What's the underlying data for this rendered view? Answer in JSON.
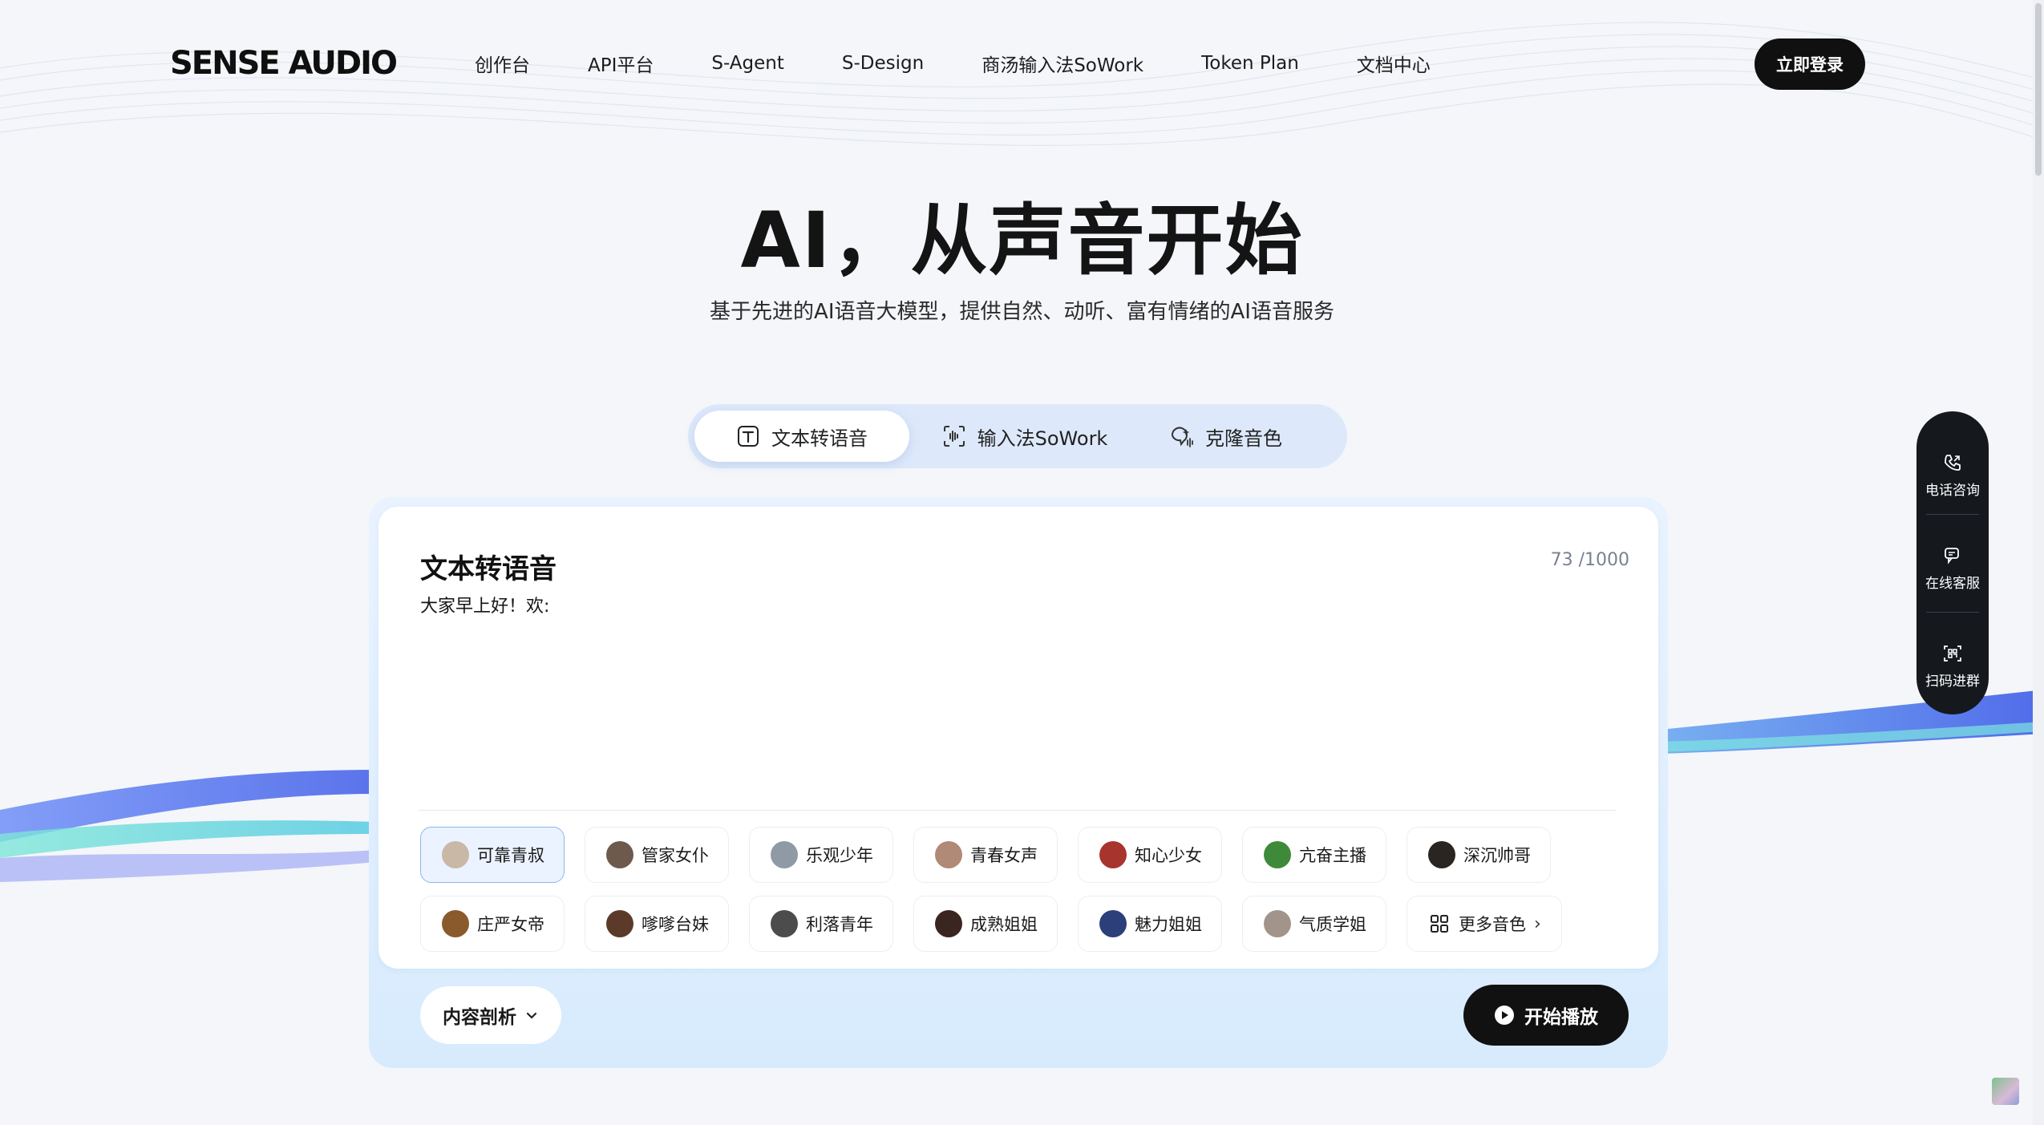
{
  "header": {
    "logo": "SENSE AUDIO",
    "nav": [
      "创作台",
      "API平台",
      "S-Agent",
      "S-Design",
      "商汤输入法SoWork",
      "Token Plan",
      "文档中心"
    ],
    "login_label": "立即登录"
  },
  "hero": {
    "title": "AI，从声音开始",
    "subtitle": "基于先进的AI语音大模型，提供自然、动听、富有情绪的AI语音服务"
  },
  "tabs": [
    {
      "label": "文本转语音",
      "icon": "text-t-icon",
      "active": true
    },
    {
      "label": "输入法SoWork",
      "icon": "voice-scan-icon",
      "active": false
    },
    {
      "label": "克隆音色",
      "icon": "clone-voice-icon",
      "active": false
    }
  ],
  "panel": {
    "title": "文本转语音",
    "char_count": "73 /1000",
    "text": "大家早上好！欢:",
    "voices": [
      {
        "name": "可靠青叔",
        "selected": true,
        "avatar": "#c9b8a6"
      },
      {
        "name": "管家女仆",
        "selected": false,
        "avatar": "#6d5a4c"
      },
      {
        "name": "乐观少年",
        "selected": false,
        "avatar": "#8f9aa6"
      },
      {
        "name": "青春女声",
        "selected": false,
        "avatar": "#b08977"
      },
      {
        "name": "知心少女",
        "selected": false,
        "avatar": "#a8342e"
      },
      {
        "name": "亢奋主播",
        "selected": false,
        "avatar": "#3f8a3a"
      },
      {
        "name": "深沉帅哥",
        "selected": false,
        "avatar": "#2b2522"
      },
      {
        "name": "庄严女帝",
        "selected": false,
        "avatar": "#8a5a2c"
      },
      {
        "name": "嗲嗲台妹",
        "selected": false,
        "avatar": "#5c3a2a"
      },
      {
        "name": "利落青年",
        "selected": false,
        "avatar": "#4c4c4c"
      },
      {
        "name": "成熟姐姐",
        "selected": false,
        "avatar": "#3a2520"
      },
      {
        "name": "魅力姐姐",
        "selected": false,
        "avatar": "#2c3f7a"
      },
      {
        "name": "气质学姐",
        "selected": false,
        "avatar": "#a2948a"
      }
    ],
    "more_voices_label": "更多音色",
    "analyze_label": "内容剖析",
    "play_label": "开始播放"
  },
  "side_widget": [
    {
      "label": "电话咨询",
      "icon": "phone-icon"
    },
    {
      "label": "在线客服",
      "icon": "chat-icon"
    },
    {
      "label": "扫码进群",
      "icon": "qr-scan-icon"
    }
  ]
}
